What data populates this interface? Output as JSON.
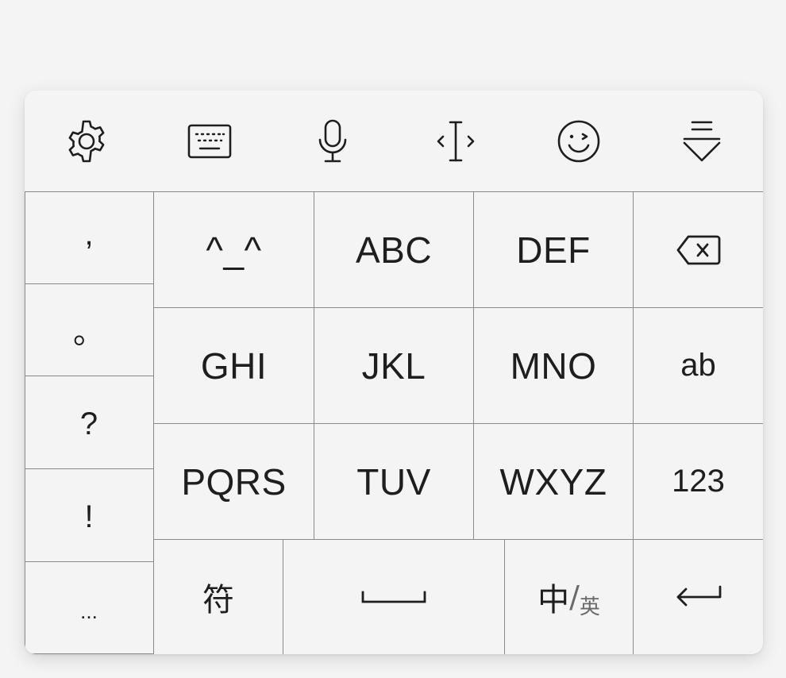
{
  "toolbar": {
    "icons": [
      "gear-icon",
      "keyboard-icon",
      "microphone-icon",
      "text-cursor-icon",
      "emoji-wink-icon",
      "collapse-keyboard-icon"
    ]
  },
  "symbols": [
    ",",
    "。",
    "?",
    "!",
    "..."
  ],
  "row1": [
    "^_^",
    "ABC",
    "DEF"
  ],
  "row2": [
    "GHI",
    "JKL",
    "MNO",
    "ab"
  ],
  "row3": [
    "PQRS",
    "TUV",
    "WXYZ",
    "123"
  ],
  "bottom": {
    "symbol_key": "符",
    "lang_primary": "中",
    "lang_slash": "/",
    "lang_secondary": "英"
  },
  "colors": {
    "background": "#f4f4f4",
    "grid_line": "#8a8a8a",
    "text": "#1e1e1e"
  }
}
